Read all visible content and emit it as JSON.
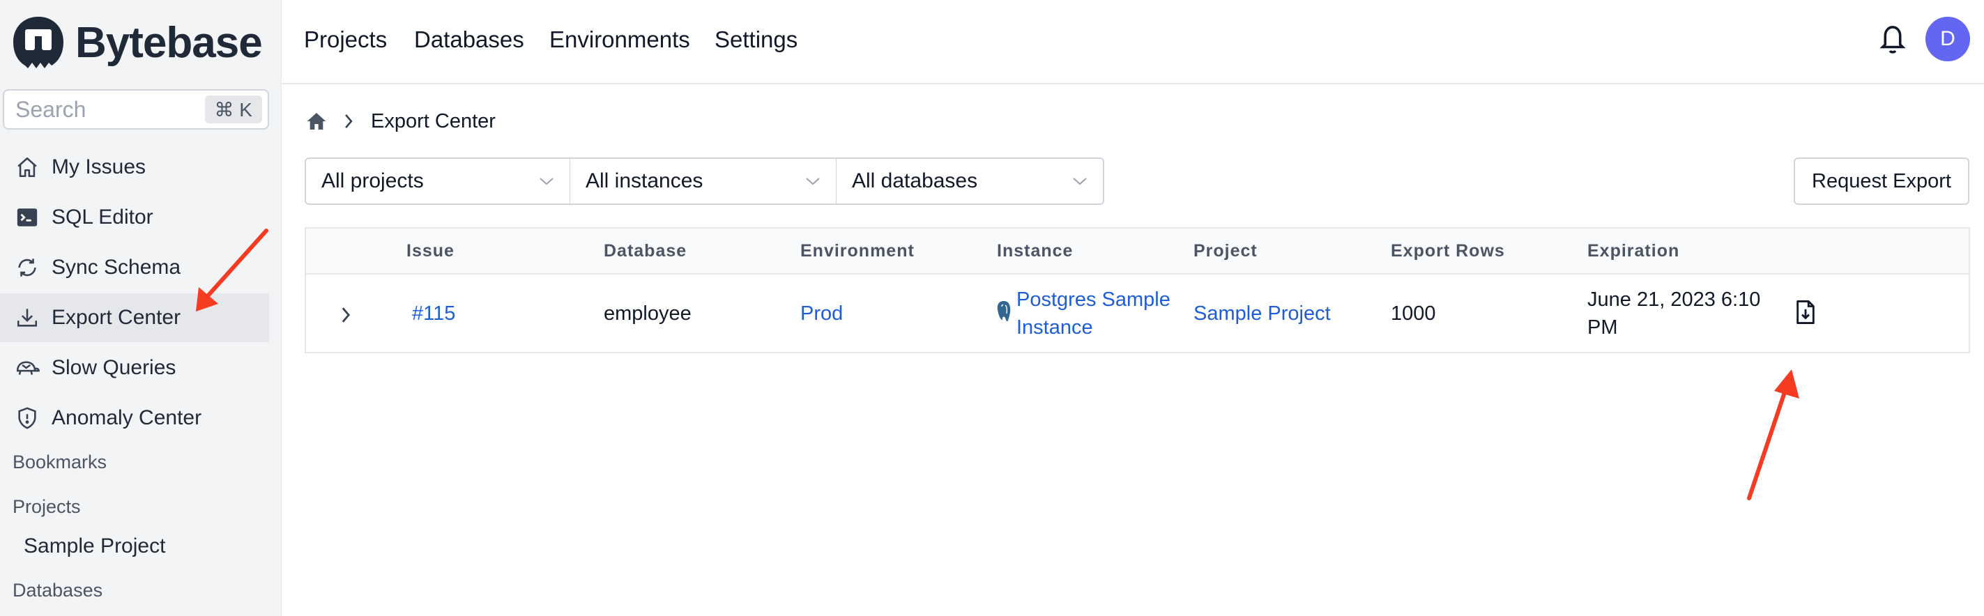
{
  "brand": {
    "name": "Bytebase"
  },
  "search": {
    "placeholder": "Search",
    "shortcut": "⌘ K"
  },
  "sidebar": {
    "items": [
      {
        "label": "My Issues",
        "icon": "home-icon"
      },
      {
        "label": "SQL Editor",
        "icon": "terminal-icon"
      },
      {
        "label": "Sync Schema",
        "icon": "sync-icon"
      },
      {
        "label": "Export Center",
        "icon": "download-icon",
        "active": true
      },
      {
        "label": "Slow Queries",
        "icon": "turtle-icon"
      },
      {
        "label": "Anomaly Center",
        "icon": "shield-icon"
      }
    ],
    "bookmarks_label": "Bookmarks",
    "projects_label": "Projects",
    "projects": [
      "Sample Project"
    ],
    "databases_label": "Databases"
  },
  "topnav": {
    "items": [
      "Projects",
      "Databases",
      "Environments",
      "Settings"
    ]
  },
  "user": {
    "initial": "D",
    "avatar_color": "#6366f1"
  },
  "breadcrumb": {
    "current": "Export Center"
  },
  "filters": {
    "project": "All projects",
    "instance": "All instances",
    "database": "All databases"
  },
  "actions": {
    "request_export": "Request Export"
  },
  "table": {
    "columns": [
      "Issue",
      "Database",
      "Environment",
      "Instance",
      "Project",
      "Export Rows",
      "Expiration"
    ],
    "rows": [
      {
        "issue": "#115",
        "database": "employee",
        "environment": "Prod",
        "instance_line1": "Postgres Sample",
        "instance_line2": "Instance",
        "project": "Sample Project",
        "export_rows": "1000",
        "expiration_line1": "June 21, 2023 6:10",
        "expiration_line2": "PM"
      }
    ]
  },
  "colors": {
    "accent": "#1d5ed8",
    "annotation_arrow": "#f53b22",
    "sidebar_bg": "#f3f4f6"
  }
}
